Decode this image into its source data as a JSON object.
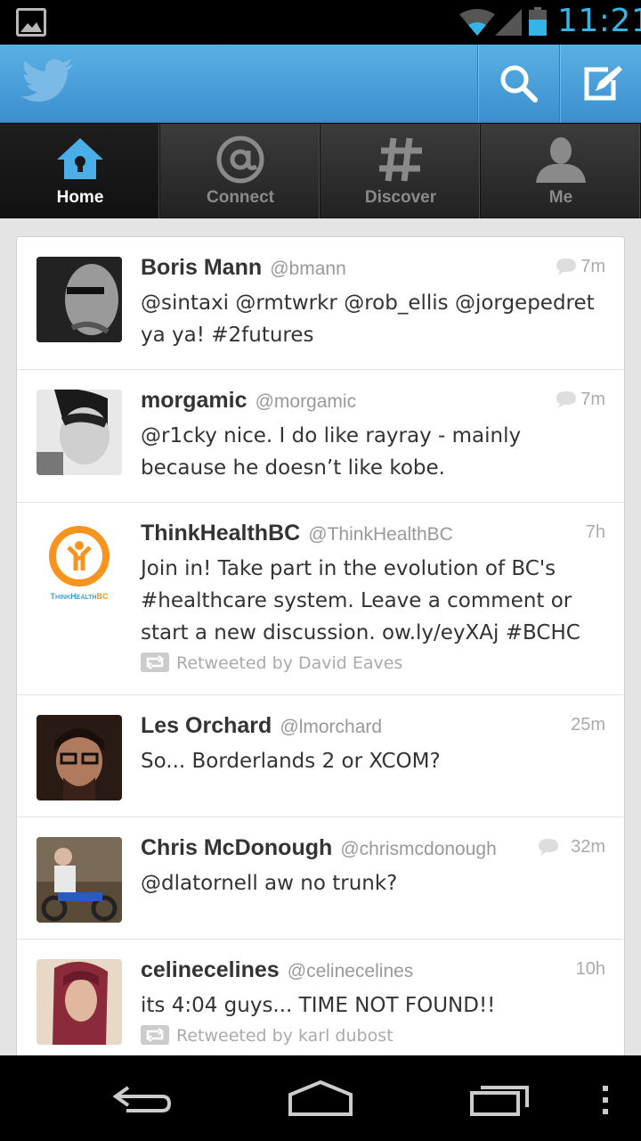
{
  "status_bar": {
    "time": "11:21",
    "icons": [
      "gallery-notification-icon",
      "wifi-icon",
      "signal-icon",
      "battery-icon"
    ]
  },
  "action_bar": {
    "logo": "twitter-bird-icon",
    "buttons": [
      "search-icon",
      "compose-icon"
    ],
    "color": "#4aa3dd"
  },
  "tabs": [
    {
      "label": "Home",
      "icon": "home-icon",
      "active": true
    },
    {
      "label": "Connect",
      "icon": "at-icon",
      "active": false
    },
    {
      "label": "Discover",
      "icon": "hash-icon",
      "active": false
    },
    {
      "label": "Me",
      "icon": "person-icon",
      "active": false
    }
  ],
  "tweets": [
    {
      "name": "Boris Mann",
      "handle": "@bmann",
      "time": "7m",
      "reply": true,
      "text": "@sintaxi @rmtwrkr @rob_ellis @jorgepedret ya ya! #2futures",
      "retweeted_by": ""
    },
    {
      "name": "morgamic",
      "handle": "@morgamic",
      "time": "7m",
      "reply": true,
      "text": "@r1cky nice. I do like rayray - mainly because he doesn’t like kobe.",
      "retweeted_by": ""
    },
    {
      "name": "ThinkHealthBC",
      "handle": "@ThinkHealthBC",
      "time": "7h",
      "reply": false,
      "text": "Join in! Take part in the evolution of BC's #healthcare system. Leave a comment or start a new discussion. ow.ly/eyXAj #BCHC",
      "retweeted_by": "Retweeted by David Eaves",
      "avatar_text": "ThinkHealthBC"
    },
    {
      "name": "Les Orchard",
      "handle": "@lmorchard",
      "time": "25m",
      "reply": false,
      "text": "So... Borderlands 2 or XCOM?",
      "retweeted_by": ""
    },
    {
      "name": "Chris McDonough",
      "handle": "@chrismcdonough",
      "time": "32m",
      "reply": true,
      "text": "@dlatornell aw no trunk?",
      "retweeted_by": ""
    },
    {
      "name": "celinecelines",
      "handle": "@celinecelines",
      "time": "10h",
      "reply": false,
      "text": "its 4:04 guys... TIME NOT FOUND!!",
      "retweeted_by": "Retweeted by karl dubost"
    }
  ],
  "nav_bar": [
    "back-icon",
    "home-icon",
    "recent-apps-icon",
    "menu-icon"
  ]
}
